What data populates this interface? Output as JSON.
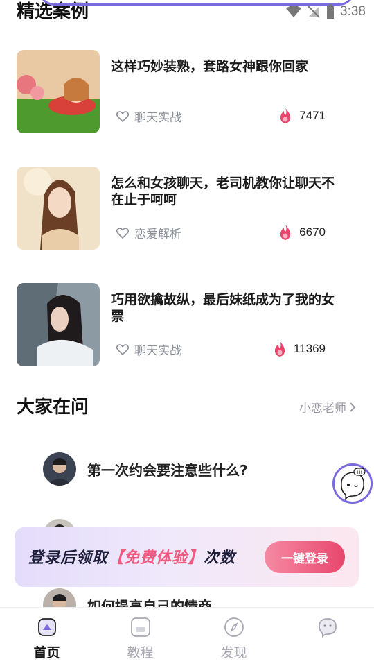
{
  "status": {
    "time": "3:38"
  },
  "cases": {
    "title": "精选案例",
    "items": [
      {
        "title": "这样巧妙装熟，套路女神跟你回家",
        "tag": "聊天实战",
        "count": "7471"
      },
      {
        "title": "怎么和女孩聊天，老司机教你让聊天不在止于呵呵",
        "tag": "恋爱解析",
        "count": "6670"
      },
      {
        "title": "巧用欲擒故纵，最后妹纸成为了我的女票",
        "tag": "聊天实战",
        "count": "11369"
      }
    ]
  },
  "questions": {
    "title": "大家在问",
    "more_label": "小恋老师",
    "items": [
      {
        "text": "第一次约会要注意些什么?"
      },
      {
        "text": "如何提高自己的情商"
      }
    ]
  },
  "banner": {
    "promo_prefix": "登录后领取",
    "promo_highlight": "【免费体验】",
    "promo_suffix": "次数",
    "login_label": "一键登录",
    "bot_badge": "HI"
  },
  "nav": {
    "items": [
      {
        "label": "首页"
      },
      {
        "label": "教程"
      },
      {
        "label": "发现"
      },
      {
        "label": ""
      }
    ]
  },
  "colors": {
    "accent": "#7a6ae0",
    "hot": "#e8466d",
    "muted": "#8a8f99"
  }
}
